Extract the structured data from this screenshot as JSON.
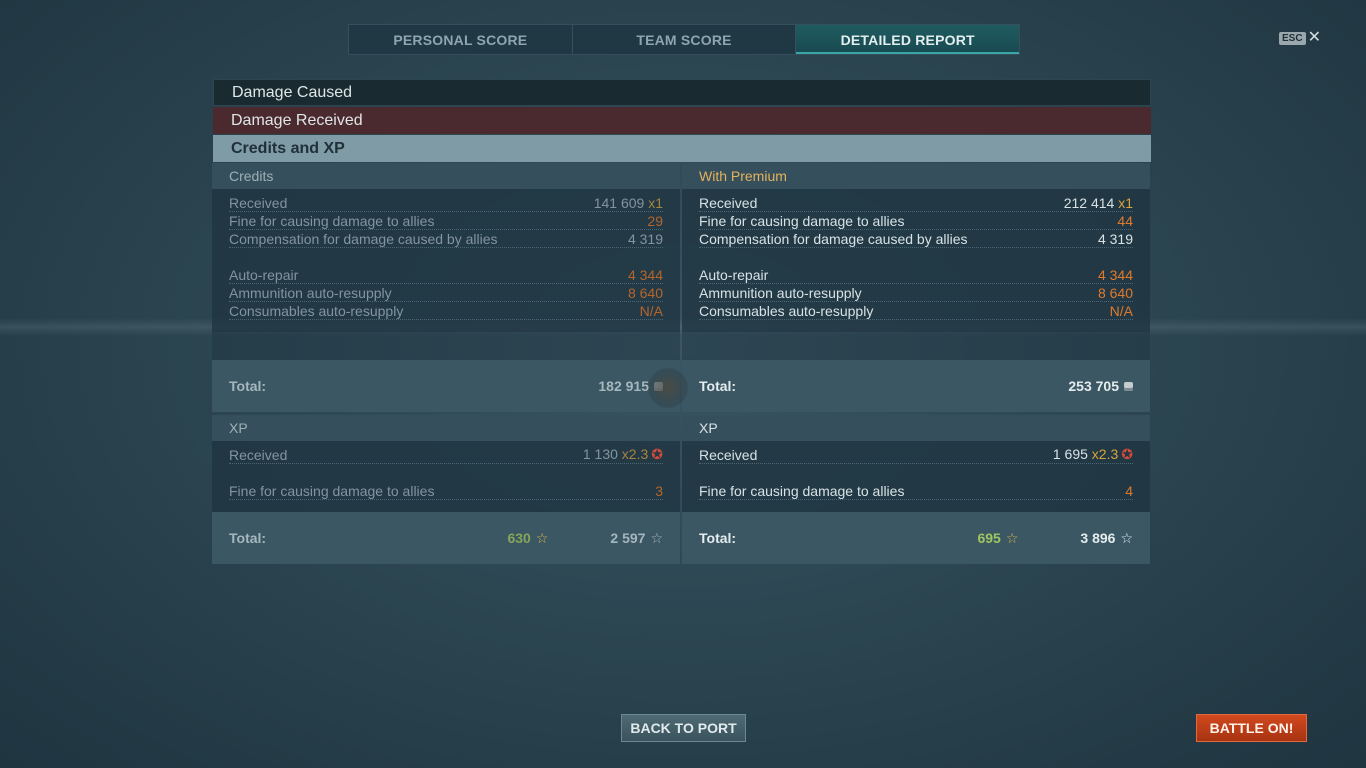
{
  "tabs": [
    {
      "label": "PERSONAL SCORE",
      "active": false
    },
    {
      "label": "TEAM SCORE",
      "active": false
    },
    {
      "label": "DETAILED REPORT",
      "active": true
    }
  ],
  "esc": {
    "key": "ESC",
    "close": "✕"
  },
  "sections": {
    "damage_caused": "Damage Caused",
    "damage_received": "Damage Received",
    "credits_xp": "Credits and XP"
  },
  "credits": {
    "header": "Credits",
    "received": {
      "label": "Received",
      "value": "141 609",
      "mult": "x1"
    },
    "fine": {
      "label": "Fine for causing damage to allies",
      "value": "29"
    },
    "compensation": {
      "label": "Compensation for damage caused by allies",
      "value": "4 319"
    },
    "auto_repair": {
      "label": "Auto-repair",
      "value": "4 344"
    },
    "ammo": {
      "label": "Ammunition auto-resupply",
      "value": "8 640"
    },
    "consumables": {
      "label": "Consumables auto-resupply",
      "value": "N/A"
    },
    "total_label": "Total:",
    "total_value": "182 915"
  },
  "premium": {
    "header": "With Premium",
    "received": {
      "label": "Received",
      "value": "212 414",
      "mult": "x1"
    },
    "fine": {
      "label": "Fine for causing damage to allies",
      "value": "44"
    },
    "compensation": {
      "label": "Compensation for damage caused by allies",
      "value": "4 319"
    },
    "auto_repair": {
      "label": "Auto-repair",
      "value": "4 344"
    },
    "ammo": {
      "label": "Ammunition auto-resupply",
      "value": "8 640"
    },
    "consumables": {
      "label": "Consumables auto-resupply",
      "value": "N/A"
    },
    "total_label": "Total:",
    "total_value": "253 705"
  },
  "xp_left": {
    "header": "XP",
    "received": {
      "label": "Received",
      "value": "1 130",
      "mult": "x2.3"
    },
    "fine": {
      "label": "Fine for causing damage to allies",
      "value": "3"
    },
    "total_label": "Total:",
    "total_free": "630",
    "total_xp": "2 597"
  },
  "xp_right": {
    "header": "XP",
    "received": {
      "label": "Received",
      "value": "1 695",
      "mult": "x2.3"
    },
    "fine": {
      "label": "Fine for causing damage to allies",
      "value": "4"
    },
    "total_label": "Total:",
    "total_free": "695",
    "total_xp": "3 896"
  },
  "icons": {
    "star": "☆",
    "xp_star": "✪"
  },
  "buttons": {
    "back": "BACK TO PORT",
    "battle": "BATTLE ON!"
  }
}
